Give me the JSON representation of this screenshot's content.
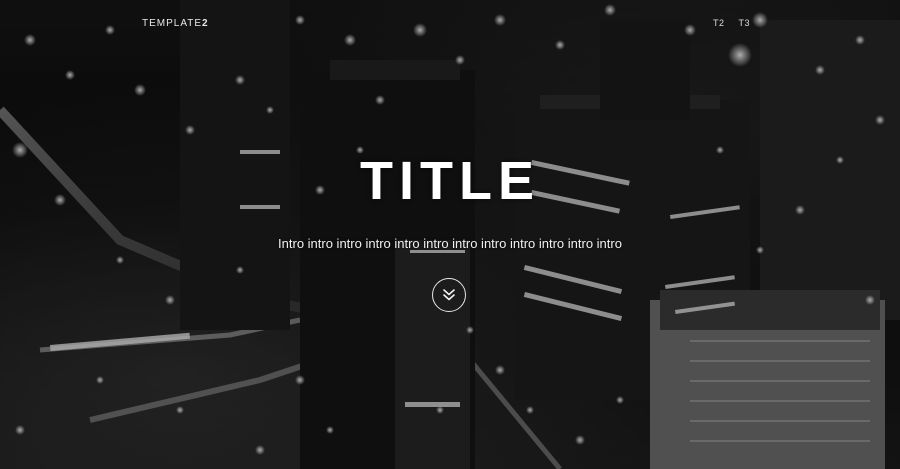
{
  "nav": {
    "brand_prefix": "TEMPLATE",
    "brand_suffix": "2",
    "links": [
      {
        "label": "T2"
      },
      {
        "label": "T3"
      }
    ]
  },
  "hero": {
    "title": "TITLE",
    "intro": "Intro intro intro intro intro intro intro intro intro intro intro intro",
    "scroll_icon": "double-chevron-down-icon"
  },
  "colors": {
    "text": "#ffffff",
    "background": "#000000"
  }
}
